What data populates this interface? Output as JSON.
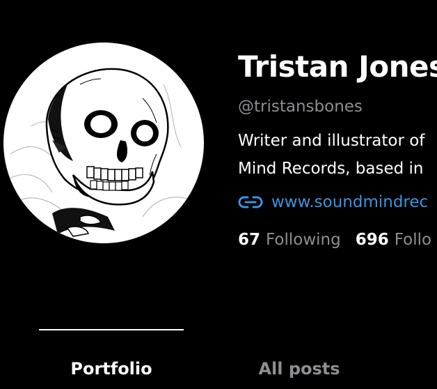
{
  "profile": {
    "name": "Tristan Jones",
    "handle": "@tristansbones",
    "bio_line1": "Writer and illustrator of",
    "bio_line2": "Mind Records, based in",
    "website": "www.soundmindrec",
    "avatar_icon": "skull-illustration"
  },
  "stats": {
    "following_count": "67",
    "following_label": "Following",
    "followers_count": "696",
    "followers_label": "Follo"
  },
  "tabs": [
    {
      "label": "Portfolio",
      "active": true
    },
    {
      "label": "All posts",
      "active": false
    }
  ],
  "colors": {
    "background": "#000000",
    "text_primary": "#ffffff",
    "text_secondary": "#8e8e93",
    "link": "#3b94e0"
  }
}
